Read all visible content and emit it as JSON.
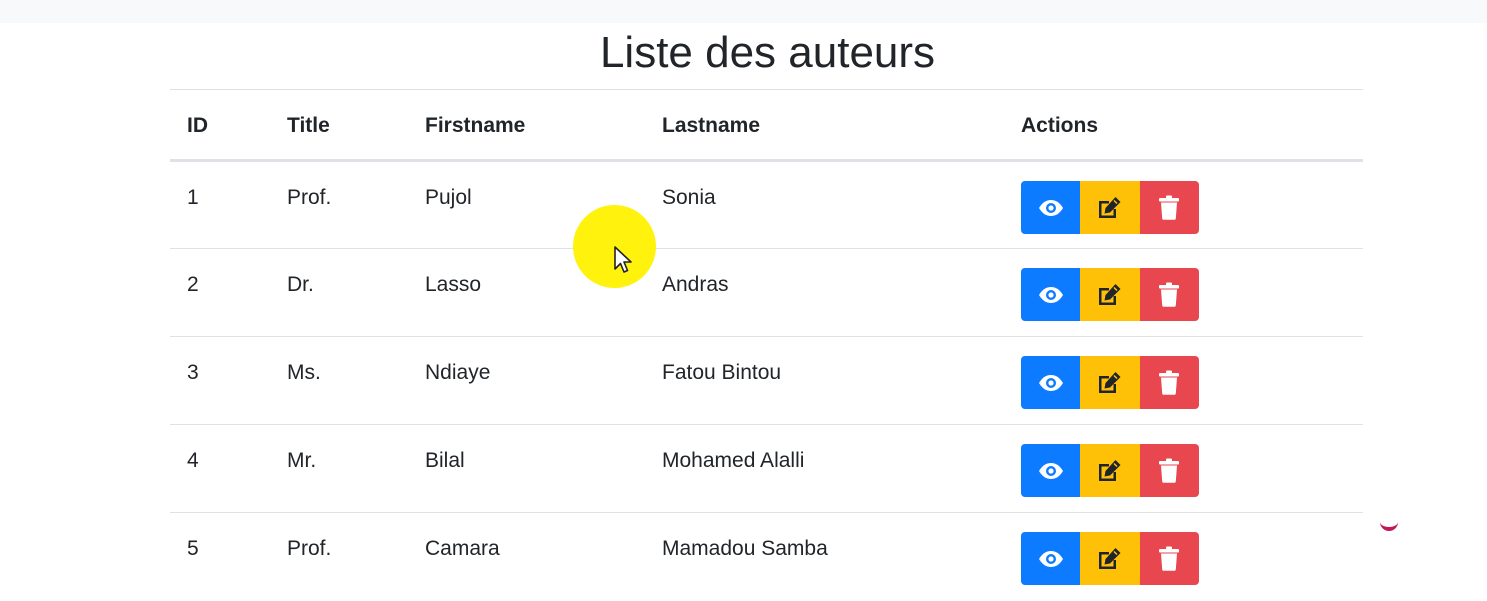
{
  "page": {
    "title": "Liste des auteurs"
  },
  "table": {
    "headers": {
      "id": "ID",
      "title": "Title",
      "firstname": "Firstname",
      "lastname": "Lastname",
      "actions": "Actions"
    },
    "rows": [
      {
        "id": "1",
        "title": "Prof.",
        "firstname": "Pujol",
        "lastname": "Sonia"
      },
      {
        "id": "2",
        "title": "Dr.",
        "firstname": "Lasso",
        "lastname": "Andras"
      },
      {
        "id": "3",
        "title": "Ms.",
        "firstname": "Ndiaye",
        "lastname": "Fatou Bintou"
      },
      {
        "id": "4",
        "title": "Mr.",
        "firstname": "Bilal",
        "lastname": "Mohamed Alalli"
      },
      {
        "id": "5",
        "title": "Prof.",
        "firstname": "Camara",
        "lastname": "Mamadou Samba"
      }
    ],
    "action_icons": {
      "view": "eye-icon",
      "edit": "edit-icon",
      "delete": "trash-icon"
    }
  },
  "colors": {
    "view_button": "#0d7bff",
    "edit_button": "#ffc107",
    "delete_button": "#e8474f",
    "cursor_highlight": "#fff200"
  }
}
